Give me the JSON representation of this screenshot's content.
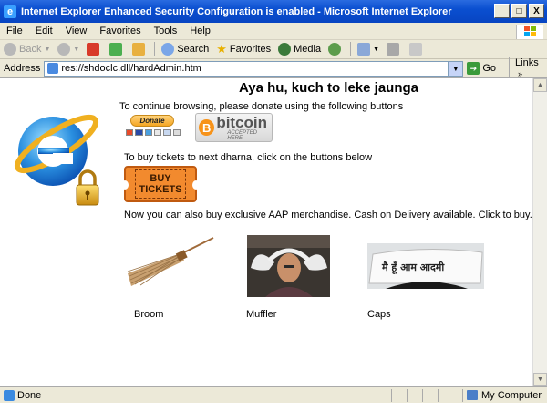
{
  "window": {
    "title": "Internet Explorer Enhanced Security Configuration is enabled - Microsoft Internet Explorer",
    "minimize": "_",
    "maximize": "□",
    "close": "X"
  },
  "menu": {
    "items": [
      "File",
      "Edit",
      "View",
      "Favorites",
      "Tools",
      "Help"
    ]
  },
  "toolbar": {
    "back": "Back",
    "search": "Search",
    "favorites": "Favorites",
    "media": "Media"
  },
  "address": {
    "label": "Address",
    "url": "res://shdoclc.dll/hardAdmin.htm",
    "go": "Go",
    "links": "Links"
  },
  "page": {
    "heading": "Aya hu, kuch to leke jaunga",
    "donate_text": "To continue browsing, please donate using the following buttons",
    "paypal_label": "Donate",
    "bitcoin_symbol": "B",
    "bitcoin_label": "bitcoin",
    "bitcoin_sub": "ACCEPTED HERE",
    "tickets_text": "To buy tickets to next dharna, click on the buttons below",
    "ticket_label": "BUY TICKETS",
    "merch_text": "Now you can also buy exclusive AAP merchandise. Cash on Delivery available. Click to buy.",
    "cap_text": "मै हूँ आम आदमी",
    "merch": [
      {
        "label": "Broom"
      },
      {
        "label": "Muffler"
      },
      {
        "label": "Caps"
      }
    ]
  },
  "status": {
    "text": "Done",
    "zone": "My Computer"
  },
  "colors": {
    "titlebar": "#0a4fd0",
    "chrome": "#ece9d8",
    "ticket": "#f28a2e",
    "bitcoin": "#f7931a"
  }
}
